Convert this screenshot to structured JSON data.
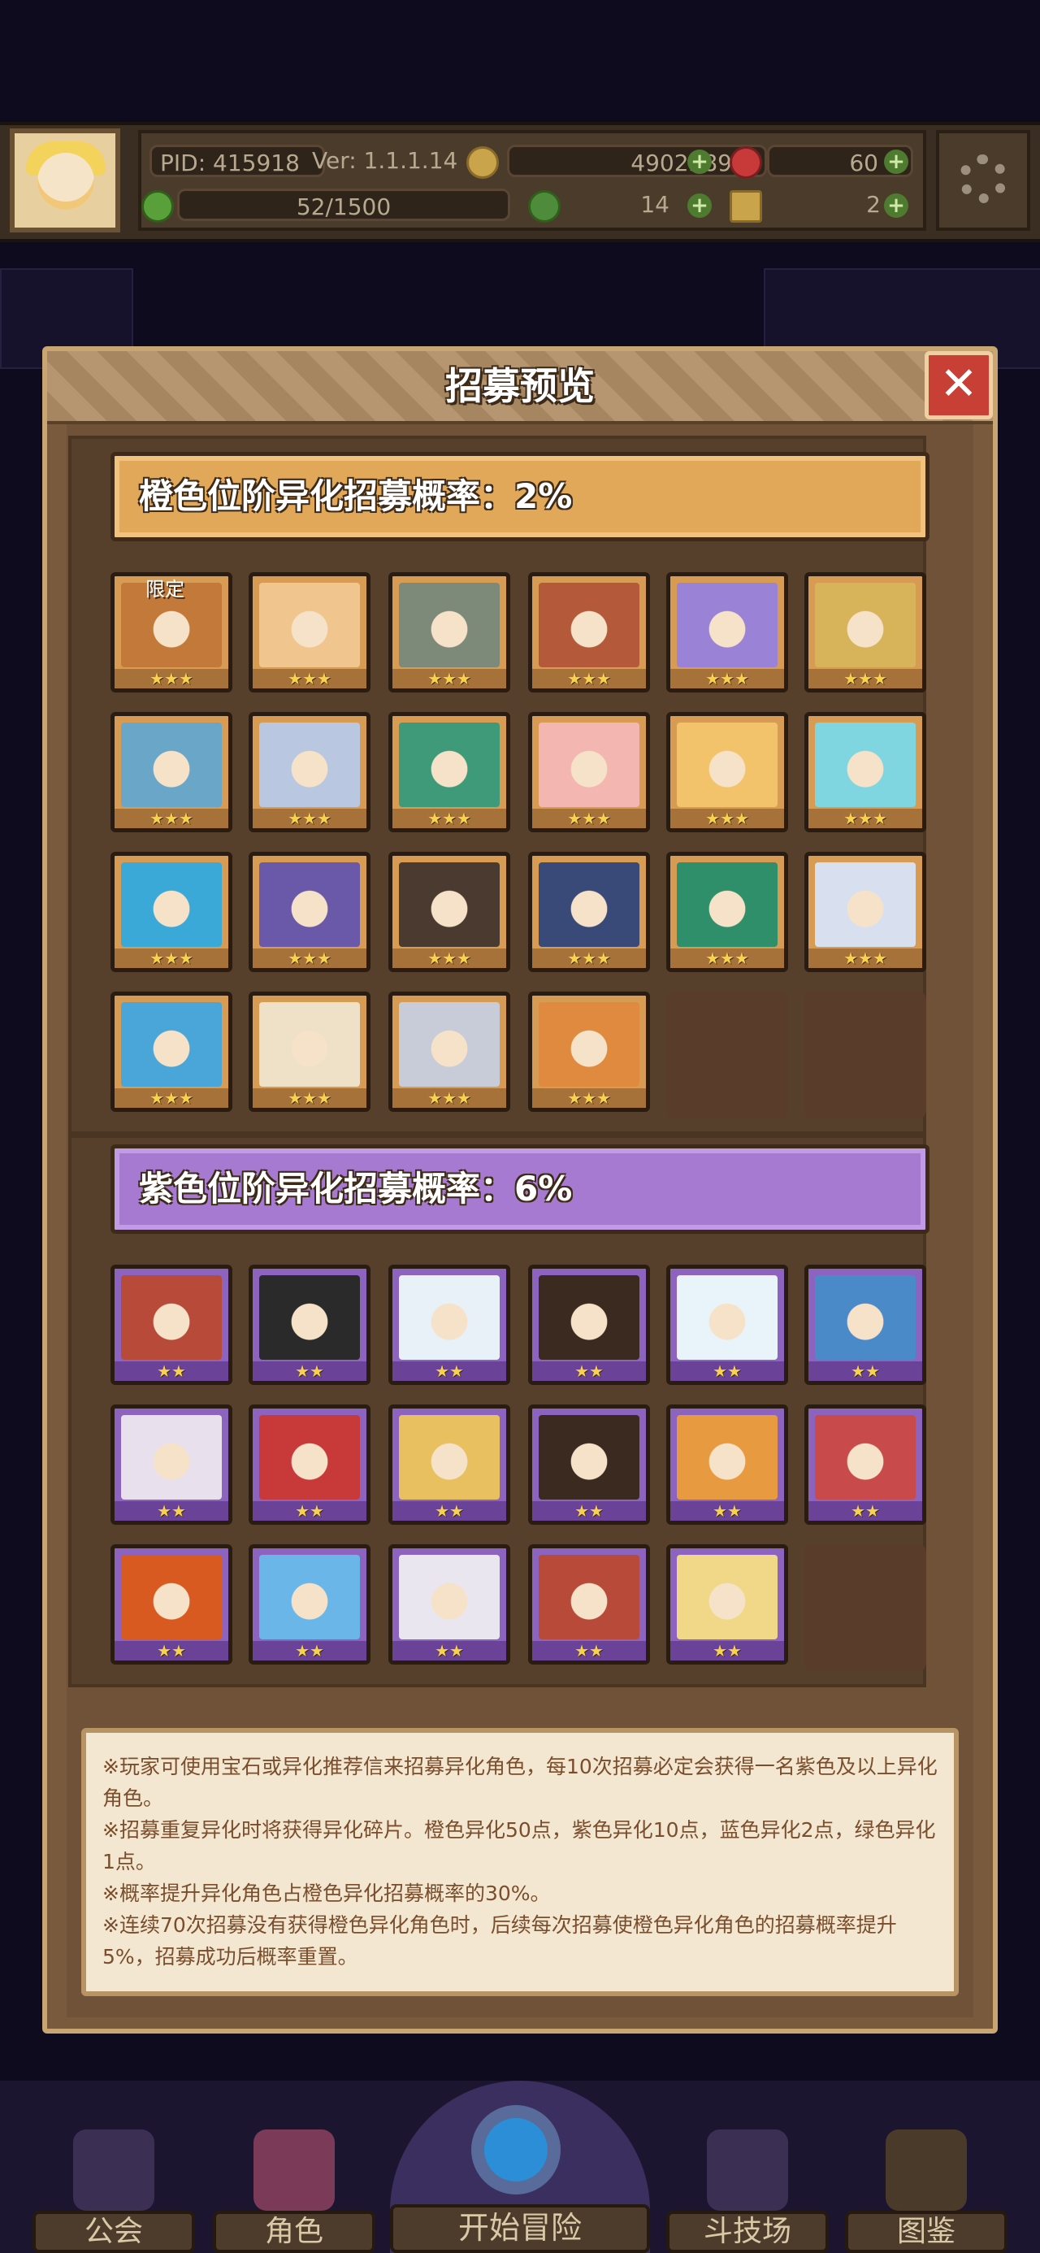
{
  "header": {
    "pid": "PID: 415918",
    "version": "Ver: 1.1.1.14",
    "gold": "4902389",
    "red_gems": "60",
    "energy": "52/1500",
    "clovers": "14",
    "keys": "2"
  },
  "modal": {
    "title": "招募预览",
    "close": "✕",
    "orange_rate": "橙色位阶异化招募概率：2%",
    "purple_rate": "紫色位阶异化招募概率：6%",
    "limited_label": "限定",
    "orange_stars": "★★★",
    "purple_stars": "★★",
    "orange_colors": [
      "#c2793a",
      "#f0c68e",
      "#7d8a7a",
      "#b45a3a",
      "#9a82d6",
      "#d7b35a",
      "#6aa6c8",
      "#b9c8e0",
      "#3f9a7a",
      "#f3b6b0",
      "#f2c36a",
      "#7fd6e0",
      "#3aa9d8",
      "#6a58a8",
      "#4a3a30",
      "#3a4a78",
      "#2f8f6a",
      "#d8e0f0",
      "#4aa6d8",
      "#efe0c8",
      "#c8ccd8",
      "#e08a40"
    ],
    "purple_colors": [
      "#b84a3a",
      "#2a2a2a",
      "#e8f0f8",
      "#3a2a20",
      "#e8f4fa",
      "#4a8ac8",
      "#e8e0ec",
      "#c83a3a",
      "#e8c060",
      "#3a2a20",
      "#e89a40",
      "#c84a4a",
      "#d85a20",
      "#6ab6e8",
      "#eae6f0",
      "#b84a3a",
      "#f0d888"
    ],
    "notes": [
      "※玩家可使用宝石或异化推荐信来招募异化角色，每10次招募必定会获得一名紫色及以上异化角色。",
      "※招募重复异化时将获得异化碎片。橙色异化50点，紫色异化10点，蓝色异化2点，绿色异化1点。",
      "※概率提升异化角色占橙色异化招募概率的30%。",
      "※连续70次招募没有获得橙色异化角色时，后续每次招募使橙色异化角色的招募概率提升5%，招募成功后概率重置。"
    ]
  },
  "nav": {
    "guild": "公会",
    "characters": "角色",
    "adventure": "开始冒险",
    "arena": "斗技场",
    "codex": "图鉴"
  }
}
